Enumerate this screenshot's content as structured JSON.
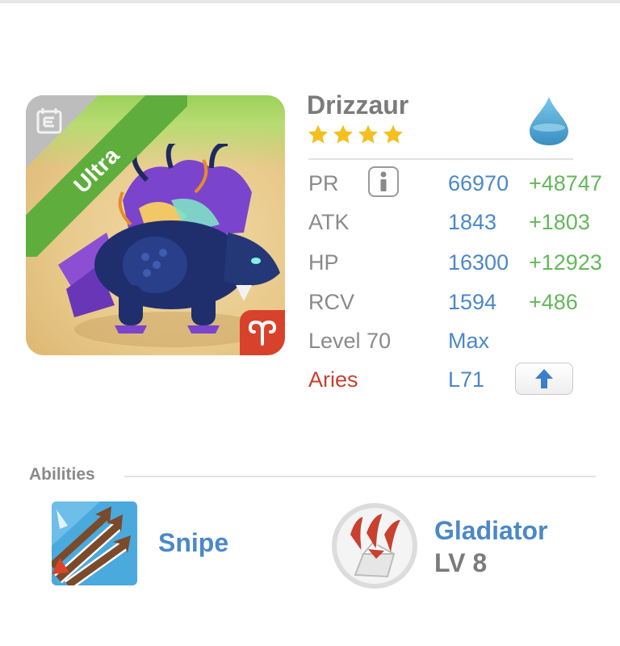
{
  "monster": {
    "name": "Drizzaur",
    "stars": 4,
    "rarity_label": "Ultra",
    "element_icon": "water-drop-icon",
    "sign_icon": "aries-symbol-icon"
  },
  "stats": {
    "pr": {
      "label": "PR",
      "value": "66970",
      "bonus": "+48747"
    },
    "atk": {
      "label": "ATK",
      "value": "1843",
      "bonus": "+1803"
    },
    "hp": {
      "label": "HP",
      "value": "16300",
      "bonus": "+12923"
    },
    "rcv": {
      "label": "RCV",
      "value": "1594",
      "bonus": "+486"
    },
    "level": {
      "label": "Level 70",
      "value": "Max"
    },
    "sign": {
      "label": "Aries",
      "value": "L71"
    }
  },
  "abilities": {
    "title": "Abilities",
    "items": [
      {
        "name": "Snipe",
        "icon": "snipe-arrows-icon"
      },
      {
        "name": "Gladiator",
        "level": "LV 8",
        "icon": "gladiator-claw-icon"
      }
    ]
  },
  "colors": {
    "blue_value": "#4b88c8",
    "green_bonus": "#64b85a",
    "red_sign": "#c9402f",
    "ultra_green": "#5fae3d"
  }
}
